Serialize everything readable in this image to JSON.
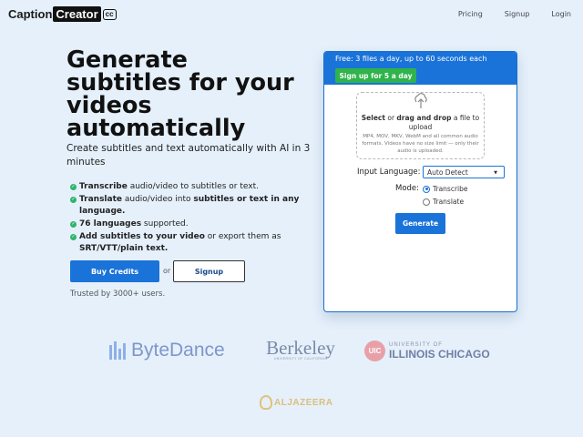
{
  "brand": {
    "name_part1": "Caption",
    "name_part2": "Creator",
    "badge": "cc"
  },
  "nav": {
    "items": [
      "Pricing",
      "Signup",
      "Login"
    ]
  },
  "hero": {
    "headline": "Generate subtitles for your videos automatically",
    "subheadline": "Create subtitles and text automatically with AI in 3 minutes",
    "features": [
      {
        "bold": "Transcribe",
        "text": " audio/video to subtitles or text.",
        "bold2": "",
        "text2": ""
      },
      {
        "bold": "Translate",
        "text": " audio/video into ",
        "bold2": "subtitles or text in any language.",
        "text2": ""
      },
      {
        "bold": "76 languages",
        "text": " supported.",
        "bold2": "",
        "text2": ""
      },
      {
        "bold": "Add subtitles to your video",
        "text": " or export them as ",
        "bold2": "SRT/VTT/plain text.",
        "text2": ""
      }
    ],
    "buy_button": "Buy Credits",
    "or_text": "or",
    "signup_button": "Signup",
    "trusted": "Trusted by 3000+ users."
  },
  "card": {
    "free_text": "Free: 3 files a day, up to 60 seconds each",
    "signup5_button": "Sign up for 5 a day",
    "upload": {
      "select": "Select",
      "or": " or ",
      "drag": "drag and drop",
      "rest": " a file to upload",
      "fine": "MP4, MOV, MKV, WebM and all common audio formats. Videos have no size limit — only their audio is uploaded."
    },
    "input_language_label": "Input Language:",
    "input_language_value": "Auto Detect",
    "mode_label": "Mode:",
    "modes": [
      "Transcribe",
      "Translate"
    ],
    "selected_mode": "Transcribe",
    "generate_button": "Generate"
  },
  "logos": {
    "bytedance": "ByteDance",
    "berkeley": "Berkeley",
    "berkeley_sub": "UNIVERSITY OF CALIFORNIA",
    "uic_line1": "UNIVERSITY OF",
    "uic_line2": "ILLINOIS CHICAGO",
    "uic_seal": "UIC",
    "aljazeera": "ALJAZEERA"
  },
  "colors": {
    "primary": "#1a73d9",
    "success": "#2fb34a",
    "background": "#e5f0fb"
  },
  "icons": {
    "upload": "upload-arrow-icon",
    "check": "check-circle-icon",
    "caret": "chevron-down-icon"
  }
}
